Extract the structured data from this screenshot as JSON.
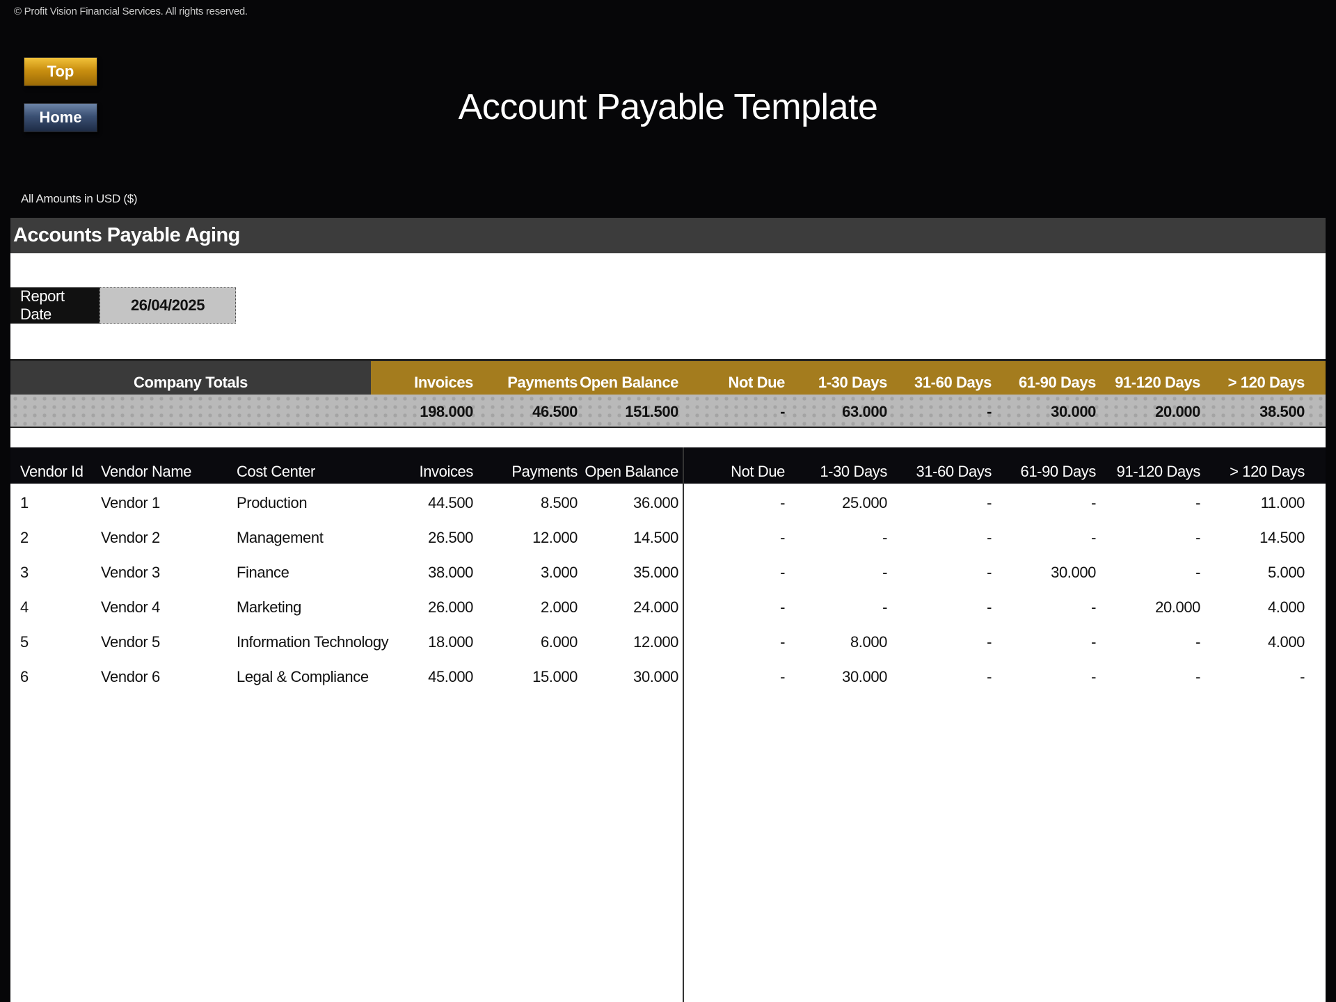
{
  "copyright": "© Profit Vision Financial Services. All rights reserved.",
  "nav": {
    "top_label": "Top",
    "home_label": "Home"
  },
  "title": "Account Payable Template",
  "amounts_note": "All Amounts in  USD ($)",
  "section_title": "Accounts Payable Aging",
  "report": {
    "label": "Report Date",
    "value": "26/04/2025"
  },
  "totals": {
    "label": "Company Totals",
    "columns": [
      "Invoices",
      "Payments",
      "Open Balance",
      "Not Due",
      "1-30 Days",
      "31-60 Days",
      "61-90 Days",
      "91-120 Days",
      "> 120 Days"
    ],
    "values": [
      "198.000",
      "46.500",
      "151.500",
      "-",
      "63.000",
      "-",
      "30.000",
      "20.000",
      "38.500"
    ]
  },
  "vendor_table": {
    "columns": [
      "Vendor Id",
      "Vendor Name",
      "Cost Center",
      "Invoices",
      "Payments",
      "Open Balance",
      "Not Due",
      "1-30 Days",
      "31-60 Days",
      "61-90 Days",
      "91-120 Days",
      "> 120 Days"
    ],
    "rows": [
      [
        "1",
        "Vendor 1",
        "Production",
        "44.500",
        "8.500",
        "36.000",
        "-",
        "25.000",
        "-",
        "-",
        "-",
        "11.000"
      ],
      [
        "2",
        "Vendor 2",
        "Management",
        "26.500",
        "12.000",
        "14.500",
        "-",
        "-",
        "-",
        "-",
        "-",
        "14.500"
      ],
      [
        "3",
        "Vendor 3",
        "Finance",
        "38.000",
        "3.000",
        "35.000",
        "-",
        "-",
        "-",
        "30.000",
        "-",
        "5.000"
      ],
      [
        "4",
        "Vendor 4",
        "Marketing",
        "26.000",
        "2.000",
        "24.000",
        "-",
        "-",
        "-",
        "-",
        "20.000",
        "4.000"
      ],
      [
        "5",
        "Vendor 5",
        "Information Technology",
        "18.000",
        "6.000",
        "12.000",
        "-",
        "8.000",
        "-",
        "-",
        "-",
        "4.000"
      ],
      [
        "6",
        "Vendor 6",
        "Legal & Compliance",
        "45.000",
        "15.000",
        "30.000",
        "-",
        "30.000",
        "-",
        "-",
        "-",
        "-"
      ]
    ]
  }
}
